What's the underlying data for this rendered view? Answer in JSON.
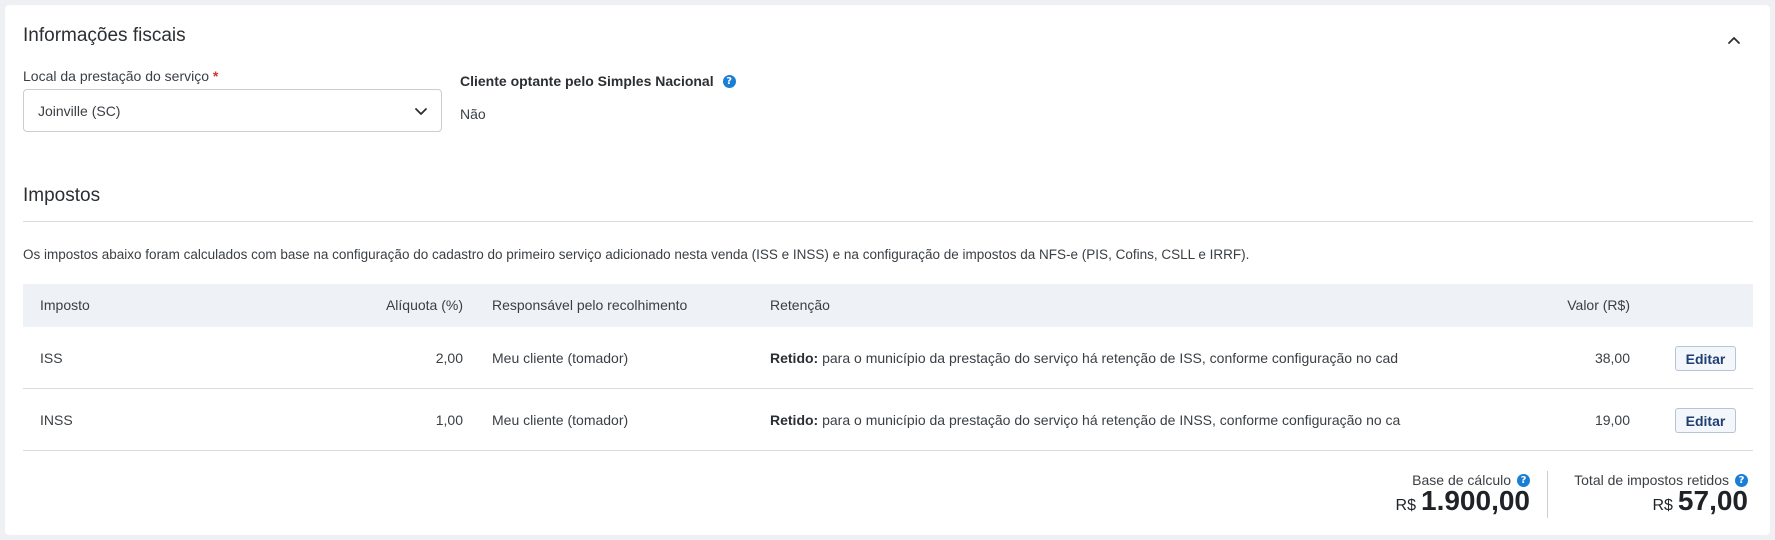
{
  "fiscal": {
    "title": "Informações fiscais",
    "location_label": "Local da prestação do serviço",
    "location_required": "*",
    "location_value": "Joinville (SC)",
    "simples_label": "Cliente optante pelo Simples Nacional",
    "simples_value": "Não"
  },
  "taxes": {
    "title": "Impostos",
    "description": "Os impostos abaixo foram calculados com base na configuração do cadastro do primeiro serviço adicionado nesta venda (ISS e INSS) e na configuração de impostos da NFS-e (PIS, Cofins, CSLL e IRRF).",
    "columns": {
      "imposto": "Imposto",
      "aliquota": "Alíquota (%)",
      "responsavel": "Responsável pelo recolhimento",
      "retencao": "Retenção",
      "valor": "Valor (R$)"
    },
    "rows": [
      {
        "imposto": "ISS",
        "aliquota": "2,00",
        "responsavel": "Meu cliente (tomador)",
        "retencao_prefix": "Retido:",
        "retencao_text": "para o município da prestação do serviço há retenção de ISS, conforme configuração no cad",
        "valor": "38,00",
        "action": "Editar"
      },
      {
        "imposto": "INSS",
        "aliquota": "1,00",
        "responsavel": "Meu cliente (tomador)",
        "retencao_prefix": "Retido:",
        "retencao_text": "para o município da prestação do serviço há retenção de INSS, conforme configuração no ca",
        "valor": "19,00",
        "action": "Editar"
      }
    ]
  },
  "totals": {
    "base_label": "Base de cálculo",
    "base_currency": "R$",
    "base_value": "1.900,00",
    "retained_label": "Total de impostos retidos",
    "retained_currency": "R$",
    "retained_value": "57,00"
  },
  "icons": {
    "collapse": "chevron-up-icon",
    "dropdown": "chevron-down-icon",
    "help": "question-circle-icon"
  },
  "colors": {
    "accent": "#1a7fd4",
    "required": "#d2343c",
    "button_text": "#1f3f73"
  }
}
